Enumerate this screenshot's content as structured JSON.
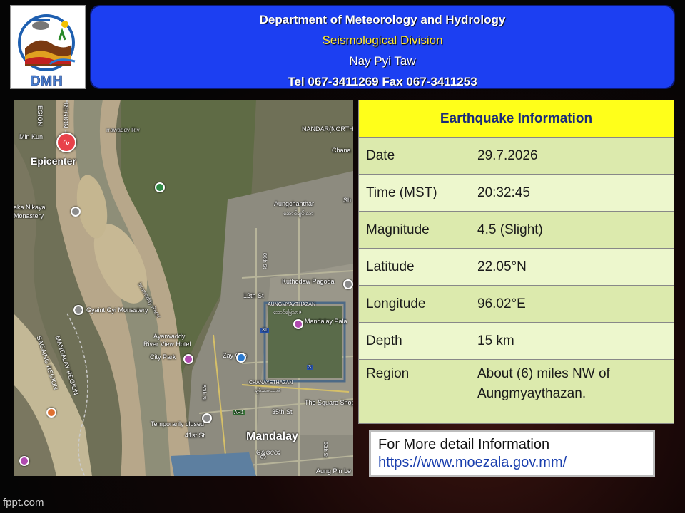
{
  "header": {
    "dept": "Department of Meteorology and Hydrology",
    "division": "Seismological Division",
    "city": "Nay Pyi Taw",
    "contact": "Tel 067-3411269 Fax 067-3411253",
    "logo_text": "DMH"
  },
  "map": {
    "epicenter_label": "Epicenter",
    "labels": {
      "min_kun": "Min Kun",
      "region_top_left": "EGION",
      "region_top": "REGION",
      "nandar": "NANDAR(NORTH",
      "chana": "Chana",
      "aungchanthar": "Aungchanthar",
      "aungchanthar_mm": "အောင်ချမ်းသာ",
      "kaka_nikaya": "aka Nikaya",
      "monastery": "Monastery",
      "kuthodaw": "Kuthodaw Pagoda",
      "twelfth_st": "12th St",
      "aungmyaythazan": "AUNGMYAYTHAZAN",
      "aungmyaythazan_mm": "အောင်မြေသာဇံ",
      "mandalay_palace": "Mandalay Pala",
      "gyaint_gyi": "Gyaint Gyi Monastery",
      "ayarwaddy": "Ayarwaddy",
      "river_view": "River View Hotel",
      "city_park": "City Park",
      "zay_cho": "Zay Cho",
      "chanayethazan": "CHANAYETHAZAN",
      "chanayethazan_mm": "ချမ်းအေးသာဇံ",
      "square": "The Square Shoppi",
      "mandalay_region": "MANDALAY REGION",
      "sagaing_region": "SAGAING REGION",
      "thirtyfifth": "35th St",
      "temp_closed": "Temporarily closed",
      "fortyfirst": "41st St",
      "mandalay": "Mandalay",
      "mandalay_mm": "မန္တလေး",
      "aung_pin": "Aung Pin Le",
      "irrawaddy": "Irrawaddy River",
      "ah1": "AH1",
      "r31": "31",
      "r3": "3",
      "eightysixth": "86th St",
      "eightieth": "80th St",
      "sixtieth": "60th St",
      "r35": "35th St",
      "shw": "Sh",
      "mawaddy": "rrawaddy Riv"
    }
  },
  "info": {
    "title": "Earthquake Information",
    "rows": [
      {
        "label": "Date",
        "value": "29.7.2026"
      },
      {
        "label": "Time (MST)",
        "value": "20:32:45"
      },
      {
        "label": "Magnitude",
        "value": "4.5 (Slight)"
      },
      {
        "label": "Latitude",
        "value": "22.05°N"
      },
      {
        "label": "Longitude",
        "value": "96.02°E"
      },
      {
        "label": "Depth",
        "value": "15 km"
      }
    ],
    "region_label": "Region",
    "region_line1": "About (6)  miles NW of",
    "region_line2": "Aungmyaythazan."
  },
  "more": {
    "line1": "For More detail Information",
    "line2": "https://www.moezala.gov.mm/"
  },
  "watermark": "fppt.com",
  "colors": {
    "header_bg": "#1c3ff2",
    "division_text": "#ffe93a",
    "table_header_bg": "#ffff1a",
    "row_dark": "#dceaad",
    "row_light": "#edf7cd",
    "epicenter_pin": "#e8414a"
  }
}
